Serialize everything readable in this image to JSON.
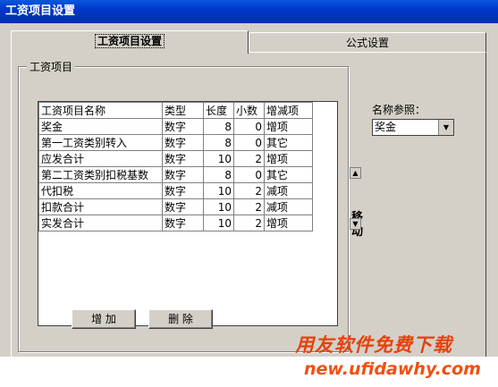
{
  "window": {
    "title": "工资项目设置"
  },
  "tabs": [
    {
      "label": "工资项目设置"
    },
    {
      "label": "公式设置"
    }
  ],
  "group": {
    "label": "工资项目"
  },
  "table": {
    "headers": [
      "工资项目名称",
      "类型",
      "长度",
      "小数",
      "增减项"
    ],
    "rows": [
      [
        "奖金",
        "数字",
        "8",
        "0",
        "增项"
      ],
      [
        "第一工资类别转入",
        "数字",
        "8",
        "0",
        "其它"
      ],
      [
        "应发合计",
        "数字",
        "10",
        "2",
        "增项"
      ],
      [
        "第二工资类别扣税基数",
        "数字",
        "8",
        "0",
        "其它"
      ],
      [
        "代扣税",
        "数字",
        "10",
        "2",
        "减项"
      ],
      [
        "扣款合计",
        "数字",
        "10",
        "2",
        "减项"
      ],
      [
        "实发合计",
        "数字",
        "10",
        "2",
        "增项"
      ]
    ]
  },
  "buttons": {
    "add": "增 加",
    "delete": "删 除"
  },
  "name_ref": {
    "label": "名称参照：",
    "value": "奖金"
  },
  "move": {
    "label": "移动"
  },
  "watermark": {
    "line1": "用友软件免费下载",
    "line2": "new.ufidawhy.com"
  },
  "icons": {
    "up": "triangle-up-icon",
    "down": "triangle-down-icon",
    "dropdown": "chevron-down-icon"
  }
}
